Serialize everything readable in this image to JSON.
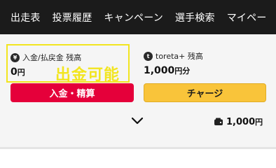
{
  "nav": {
    "items": [
      "出走表",
      "投票履歴",
      "キャンペーン",
      "選手検索",
      "マイペー"
    ]
  },
  "cash_balance": {
    "label": "入金/払戻金 残高",
    "value": "0",
    "unit": "円",
    "icon": "yen-coin-icon"
  },
  "toreta_balance": {
    "label": "toreta+ 残高",
    "value": "1,000",
    "unit": "円分",
    "icon": "toreta-coin-icon"
  },
  "overlay": {
    "text": "出金可能"
  },
  "buttons": {
    "deposit_label": "入金・精算",
    "charge_label": "チャージ"
  },
  "wallet": {
    "amount": "1,000",
    "unit": "円",
    "icon": "wallet-icon"
  },
  "colors": {
    "nav_bg": "#1b1b1b",
    "highlight": "#f2e51f",
    "deposit_button": "#e5003a",
    "charge_button": "#f9c43a"
  }
}
